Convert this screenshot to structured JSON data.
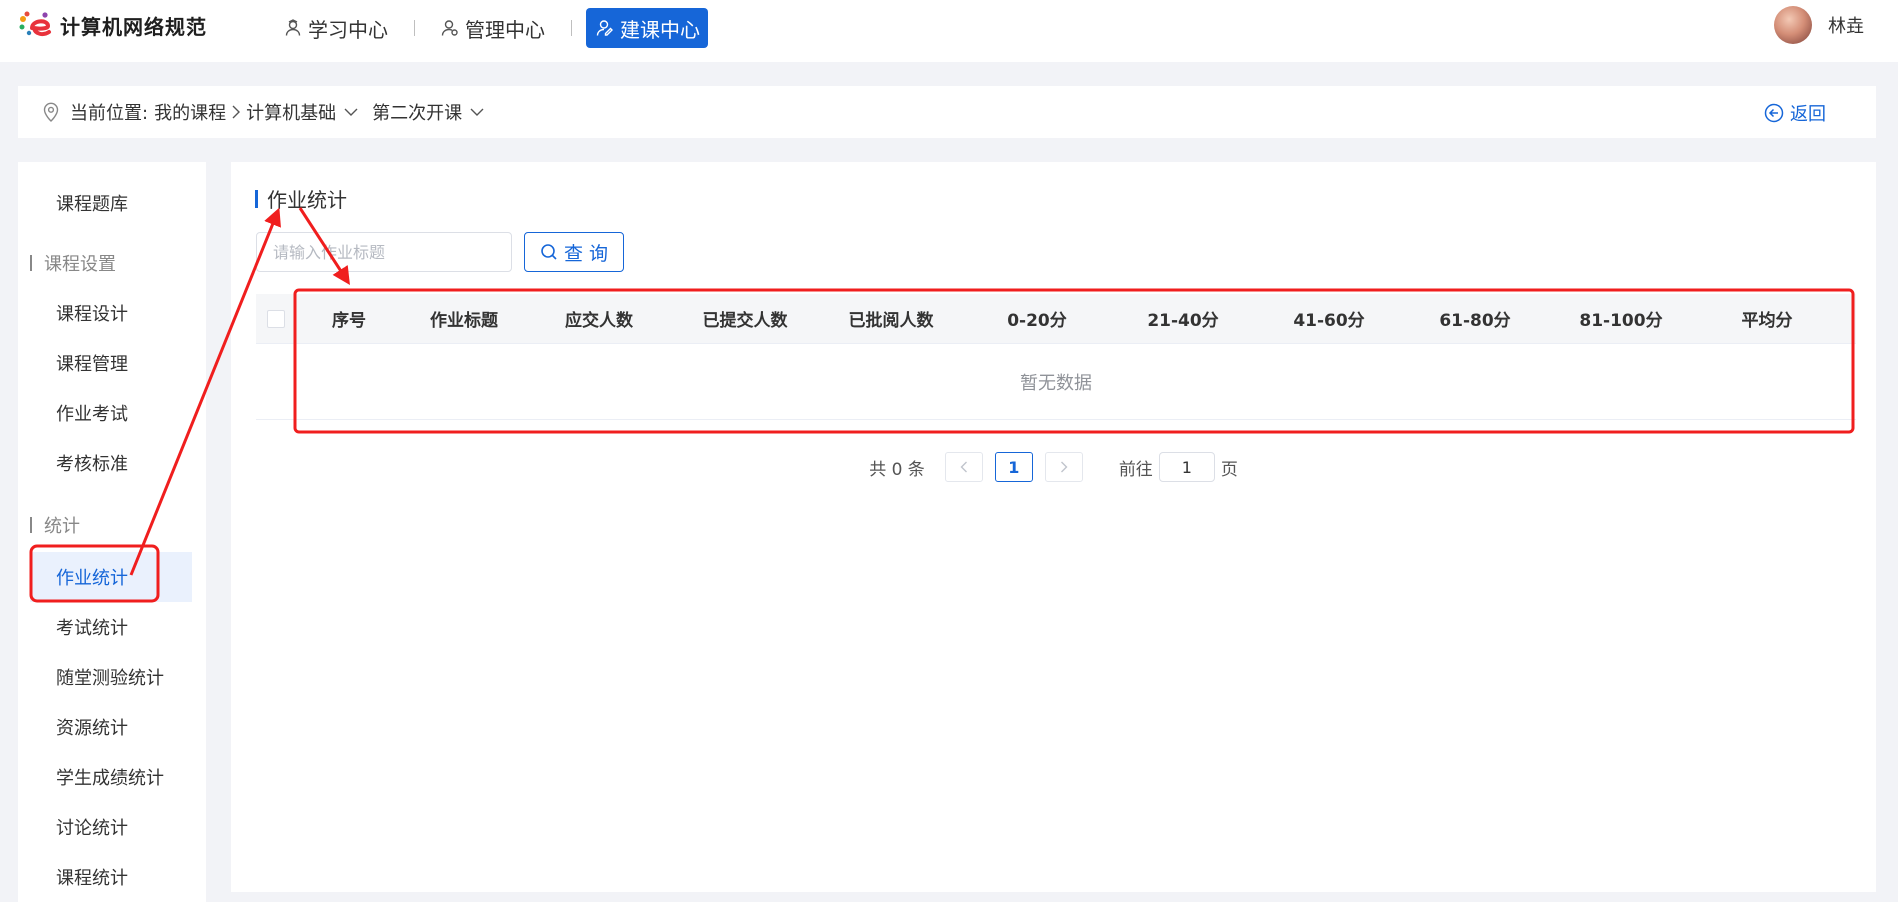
{
  "app": {
    "title": "计算机网络规范"
  },
  "nav": {
    "items": [
      {
        "label": "学习中心",
        "icon": "student-icon"
      },
      {
        "label": "管理中心",
        "icon": "manager-icon"
      },
      {
        "label": "建课中心",
        "icon": "builder-icon",
        "active": true
      }
    ]
  },
  "user": {
    "name": "林垚"
  },
  "breadcrumb": {
    "prefix": "当前位置:",
    "root": "我的课程",
    "course": "计算机基础",
    "term": "第二次开课",
    "back": "返回"
  },
  "sidebar": {
    "top_item": "课程题库",
    "groups": [
      {
        "label": "课程设置",
        "items": [
          "课程设计",
          "课程管理",
          "作业考试",
          "考核标准"
        ]
      },
      {
        "label": "统计",
        "items": [
          "作业统计",
          "考试统计",
          "随堂测验统计",
          "资源统计",
          "学生成绩统计",
          "讨论统计",
          "课程统计"
        ]
      }
    ],
    "active_item": "作业统计"
  },
  "main": {
    "section_title": "作业统计",
    "search": {
      "placeholder": "请输入作业标题",
      "value": ""
    },
    "query_label": "查 询",
    "table": {
      "columns": [
        "序号",
        "作业标题",
        "应交人数",
        "已提交人数",
        "已批阅人数",
        "0-20分",
        "21-40分",
        "41-60分",
        "61-80分",
        "81-100分",
        "平均分"
      ],
      "empty_text": "暂无数据",
      "rows": []
    },
    "pagination": {
      "total": "共 0 条",
      "current_page": "1",
      "goto_prefix": "前往",
      "goto_value": "1",
      "goto_suffix": "页"
    }
  },
  "colors": {
    "accent": "#1666d8",
    "annotation": "#f01e1e"
  }
}
